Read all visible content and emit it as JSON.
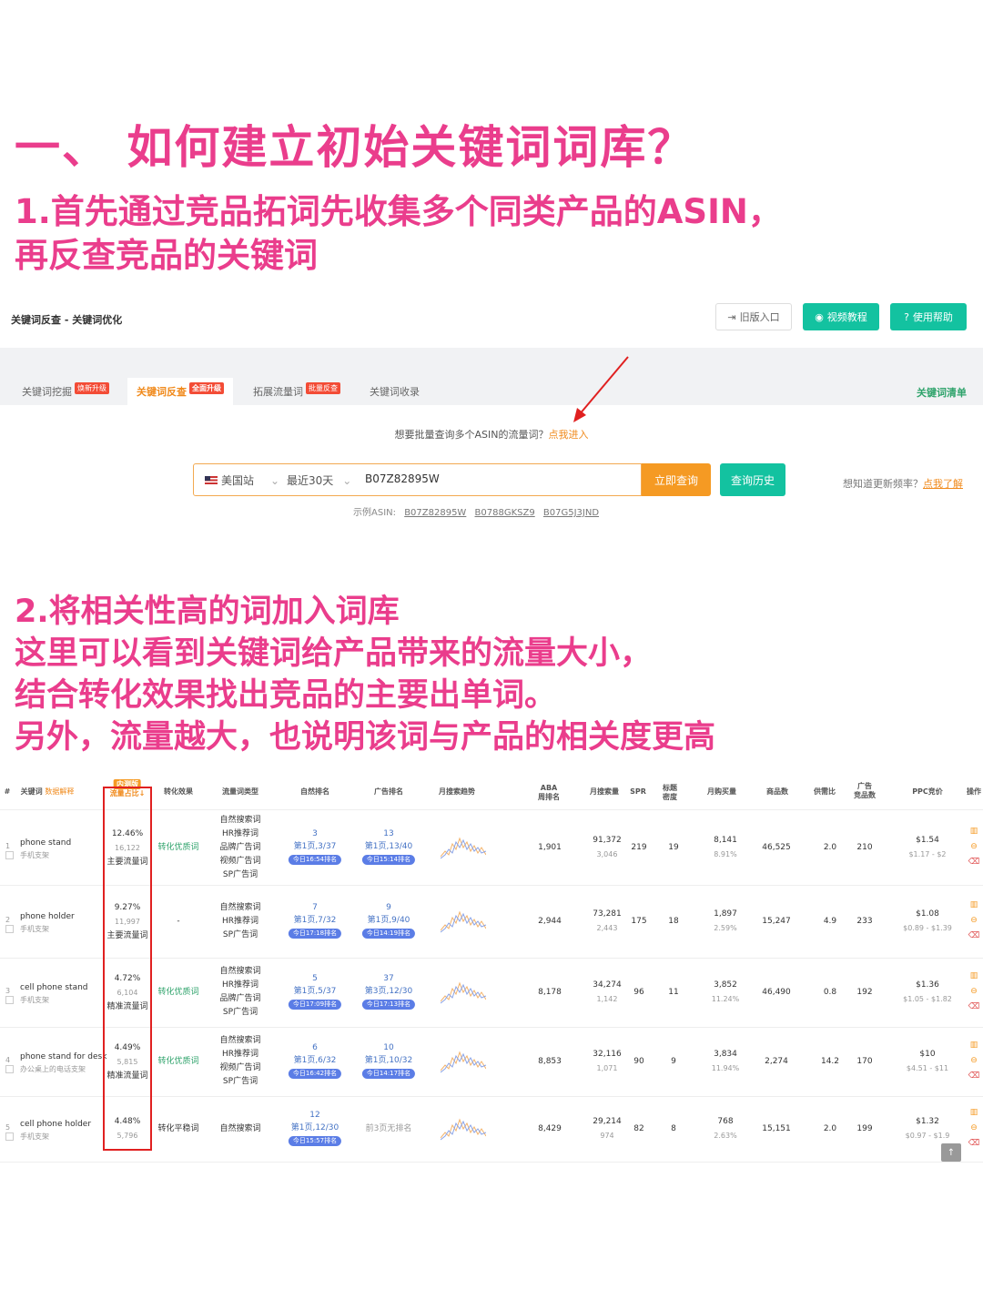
{
  "headings": {
    "h1": "一、 如何建立初始关键词词库？",
    "h2_line1": "1.首先通过竞品拓词先收集多个同类产品的ASIN，",
    "h2_line2": "再反查竞品的关键词",
    "sec2": [
      "2.将相关性高的词加入词库",
      "这里可以看到关键词给产品带来的流量大小，",
      "结合转化效果找出竞品的主要出单词。",
      "另外，流量越大，也说明该词与产品的相关度更高"
    ]
  },
  "topbar": {
    "breadcrumb": "关键词反查 - 关键词优化",
    "old_entry": "旧版入口",
    "video": "视频教程",
    "help": "使用帮助"
  },
  "tabs": [
    {
      "label": "关键词挖掘",
      "tag": "焕新升级"
    },
    {
      "label": "关键词反查",
      "tag": "全面升级"
    },
    {
      "label": "拓展流量词",
      "tag": "批量反查"
    },
    {
      "label": "关键词收录",
      "tag": ""
    }
  ],
  "tab_right": "关键词清单",
  "batch_hint": {
    "text": "想要批量查询多个ASIN的流量词？",
    "link": "点我进入"
  },
  "search": {
    "site": "美国站",
    "period": "最近30天",
    "asin": "B07Z82895W",
    "query_btn": "立即查询",
    "history_btn": "查询历史"
  },
  "freq_hint": {
    "text": "想知道更新频率？",
    "link": "点我了解"
  },
  "example": {
    "label": "示例ASIN:",
    "asins": [
      "B07Z82895W",
      "B0788GKSZ9",
      "B07G5J3JND"
    ]
  },
  "table": {
    "headers": {
      "idx": "#",
      "keyword": "关键词",
      "keyword_tag": "数据解释",
      "traffic_badge": "内测版",
      "traffic": "流量占比↓",
      "conv": "转化效果",
      "type": "流量词类型",
      "organic": "自然排名",
      "ad": "广告排名",
      "trend": "月搜索趋势",
      "aba1": "ABA",
      "aba2": "周排名",
      "search_vol": "月搜索量",
      "spr": "SPR",
      "title1": "标题",
      "title2": "密度",
      "purchase": "月购买量",
      "products": "商品数",
      "ratio": "供需比",
      "ad_prod1": "广告",
      "ad_prod2": "竞品数",
      "ppc": "PPC竞价",
      "ops": "操作"
    },
    "rows": [
      {
        "idx": "1",
        "kw": "phone stand",
        "kw_cn": "手机支架",
        "pct": "12.46%",
        "pct_sub": "16,122",
        "pct_tag": "主要流量词",
        "conv": "转化优质词",
        "types": [
          "自然搜索词",
          "HR推荐词",
          "品牌广告词",
          "视频广告词",
          "SP广告词"
        ],
        "org_top": "3",
        "org_mid": "第1页,3/37",
        "org_pill": "今日16:54排名",
        "ad_top": "13",
        "ad_mid": "第1页,13/40",
        "ad_pill": "今日15:14排名",
        "aba": "1,901",
        "sv": "91,372",
        "sv_sub": "3,046",
        "spr": "219",
        "td": "19",
        "pu": "8,141",
        "pu_sub": "8.91%",
        "pr": "46,525",
        "ratio": "2.0",
        "adp": "210",
        "ppc": "$1.54",
        "ppc_sub": "$1.17 - $2"
      },
      {
        "idx": "2",
        "kw": "phone holder",
        "kw_cn": "手机支架",
        "pct": "9.27%",
        "pct_sub": "11,997",
        "pct_tag": "主要流量词",
        "conv": "-",
        "types": [
          "自然搜索词",
          "HR推荐词",
          "SP广告词"
        ],
        "org_top": "7",
        "org_mid": "第1页,7/32",
        "org_pill": "今日17:18排名",
        "ad_top": "9",
        "ad_mid": "第1页,9/40",
        "ad_pill": "今日14:19排名",
        "aba": "2,944",
        "sv": "73,281",
        "sv_sub": "2,443",
        "spr": "175",
        "td": "18",
        "pu": "1,897",
        "pu_sub": "2.59%",
        "pr": "15,247",
        "ratio": "4.9",
        "adp": "233",
        "ppc": "$1.08",
        "ppc_sub": "$0.89 - $1.39"
      },
      {
        "idx": "3",
        "kw": "cell phone stand",
        "kw_cn": "手机支架",
        "pct": "4.72%",
        "pct_sub": "6,104",
        "pct_tag": "精准流量词",
        "conv": "转化优质词",
        "types": [
          "自然搜索词",
          "HR推荐词",
          "品牌广告词",
          "SP广告词"
        ],
        "org_top": "5",
        "org_mid": "第1页,5/37",
        "org_pill": "今日17:09排名",
        "ad_top": "37",
        "ad_mid": "第3页,12/30",
        "ad_pill": "今日17:13排名",
        "aba": "8,178",
        "sv": "34,274",
        "sv_sub": "1,142",
        "spr": "96",
        "td": "11",
        "pu": "3,852",
        "pu_sub": "11.24%",
        "pr": "46,490",
        "ratio": "0.8",
        "adp": "192",
        "ppc": "$1.36",
        "ppc_sub": "$1.05 - $1.82"
      },
      {
        "idx": "4",
        "kw": "phone stand for desk",
        "kw_cn": "办公桌上的电话支架",
        "pct": "4.49%",
        "pct_sub": "5,815",
        "pct_tag": "精准流量词",
        "conv": "转化优质词",
        "types": [
          "自然搜索词",
          "HR推荐词",
          "视频广告词",
          "SP广告词"
        ],
        "org_top": "6",
        "org_mid": "第1页,6/32",
        "org_pill": "今日16:42排名",
        "ad_top": "10",
        "ad_mid": "第1页,10/32",
        "ad_pill": "今日14:17排名",
        "aba": "8,853",
        "sv": "32,116",
        "sv_sub": "1,071",
        "spr": "90",
        "td": "9",
        "pu": "3,834",
        "pu_sub": "11.94%",
        "pr": "2,274",
        "ratio": "14.2",
        "adp": "170",
        "ppc": "$10",
        "ppc_sub": "$4.51 - $11"
      },
      {
        "idx": "5",
        "kw": "cell phone holder",
        "kw_cn": "手机支架",
        "pct": "4.48%",
        "pct_sub": "5,796",
        "pct_tag": "",
        "conv": "转化平稳词",
        "types": [
          "自然搜索词"
        ],
        "org_top": "12",
        "org_mid": "第1页,12/30",
        "org_pill": "今日15:57排名",
        "ad_top": "",
        "ad_mid": "前3页无排名",
        "ad_pill": "",
        "aba": "8,429",
        "sv": "29,214",
        "sv_sub": "974",
        "spr": "82",
        "td": "8",
        "pu": "768",
        "pu_sub": "2.63%",
        "pr": "15,151",
        "ratio": "2.0",
        "adp": "199",
        "ppc": "$1.32",
        "ppc_sub": "$0.97 - $1.9"
      }
    ]
  },
  "colors": {
    "pink": "#ea3d8c",
    "teal": "#13c2a0",
    "orange": "#f59a23",
    "red": "#e02020",
    "blue": "#5b7de6"
  }
}
